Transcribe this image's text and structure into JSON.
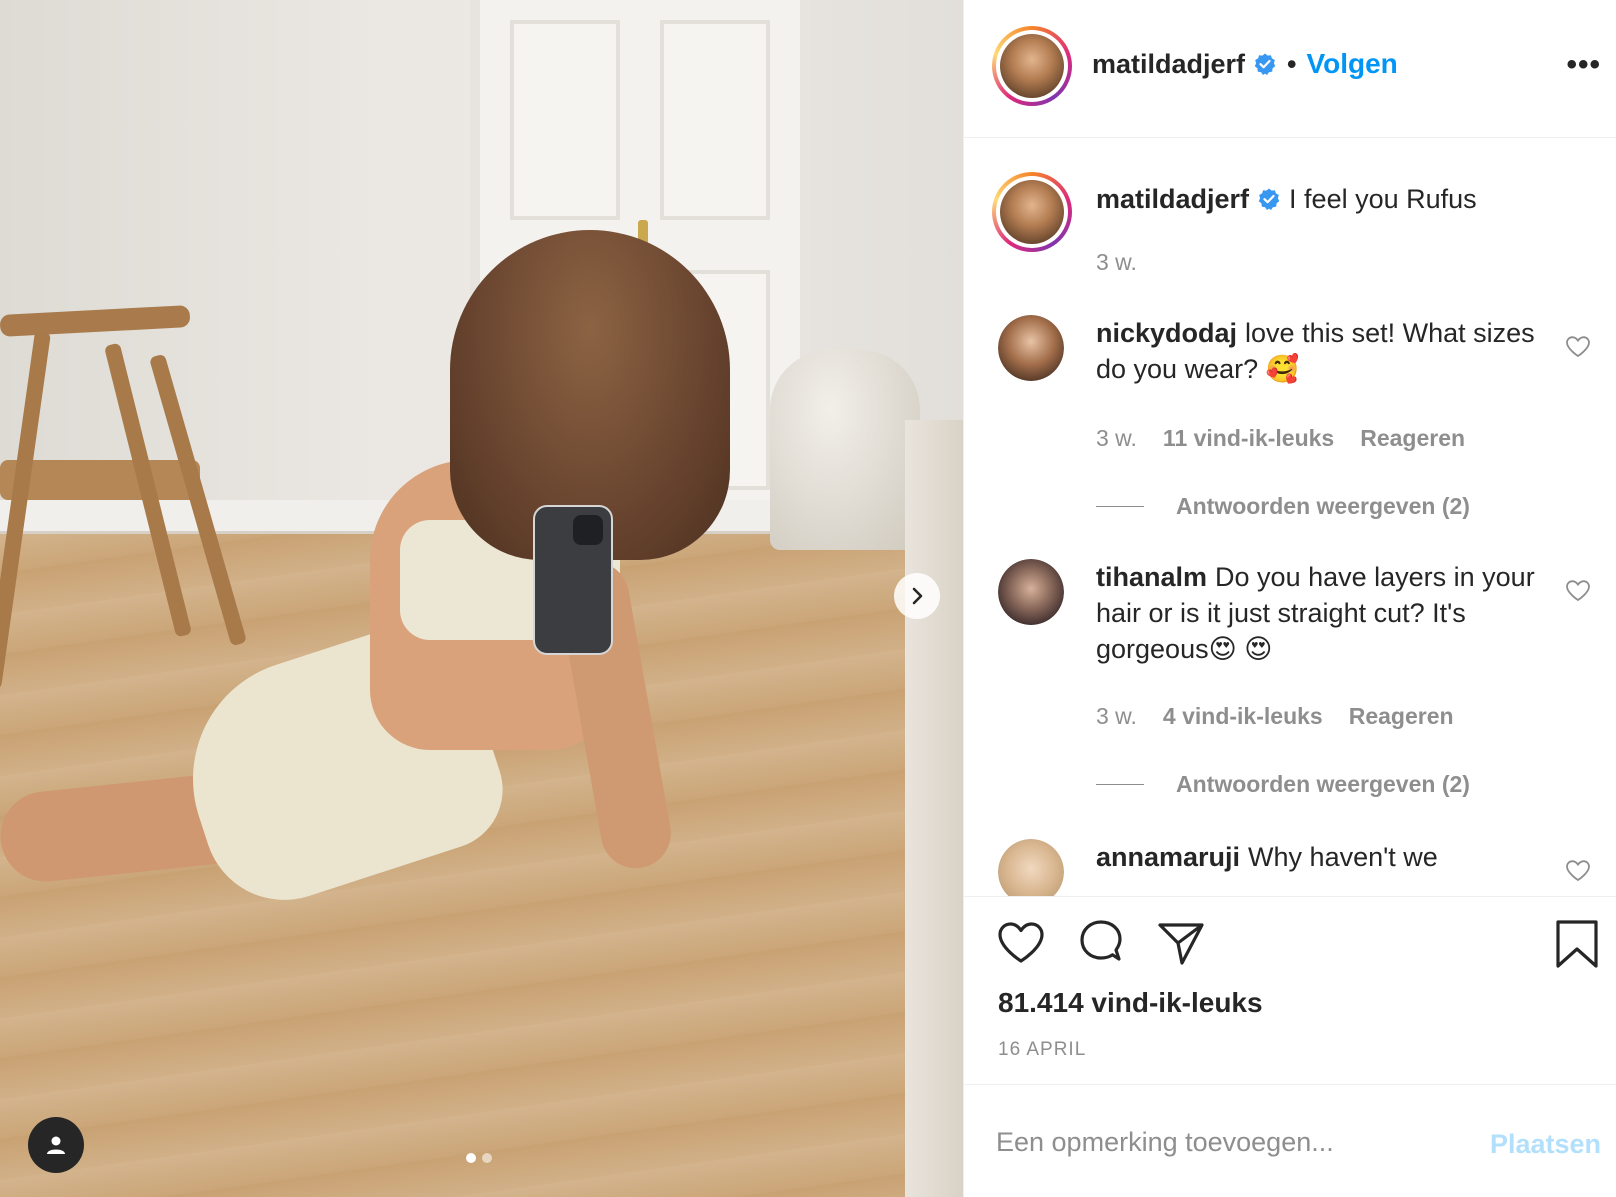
{
  "colors": {
    "link_blue": "#0095f6",
    "post_disabled": "#b2dffc",
    "muted": "#8e8e8e",
    "text": "#262626"
  },
  "media": {
    "next_icon": "chevron-right-icon",
    "user_tag_icon": "user-icon",
    "slides_total": 2,
    "active_slide": 1
  },
  "header": {
    "username": "matildadjerf",
    "verified_icon": "verified-badge-icon",
    "separator": "•",
    "follow_label": "Volgen",
    "more_label": "•••"
  },
  "caption": {
    "username": "matildadjerf",
    "text": "I feel you Rufus",
    "time": "3 w."
  },
  "comments": [
    {
      "username": "nickydodaj",
      "text": "love this set! What sizes do you wear? 🥰",
      "time": "3 w.",
      "likes": "11 vind-ik-leuks",
      "reply_label": "Reageren",
      "view_replies": "Antwoorden weergeven (2)"
    },
    {
      "username": "tihanalm",
      "text": "Do you have layers in your hair or is it just straight cut? It's gorgeous😍 😍",
      "time": "3 w.",
      "likes": "4 vind-ik-leuks",
      "reply_label": "Reageren",
      "view_replies": "Antwoorden weergeven (2)"
    },
    {
      "username": "annamaruji",
      "text": "Why haven't we"
    }
  ],
  "actions": {
    "like_icon": "heart-icon",
    "comment_icon": "comment-bubble-icon",
    "share_icon": "paper-plane-icon",
    "save_icon": "bookmark-icon",
    "likes_count": "81.414 vind-ik-leuks",
    "date": "16 APRIL"
  },
  "composer": {
    "placeholder": "Een opmerking toevoegen...",
    "post_label": "Plaatsen"
  }
}
